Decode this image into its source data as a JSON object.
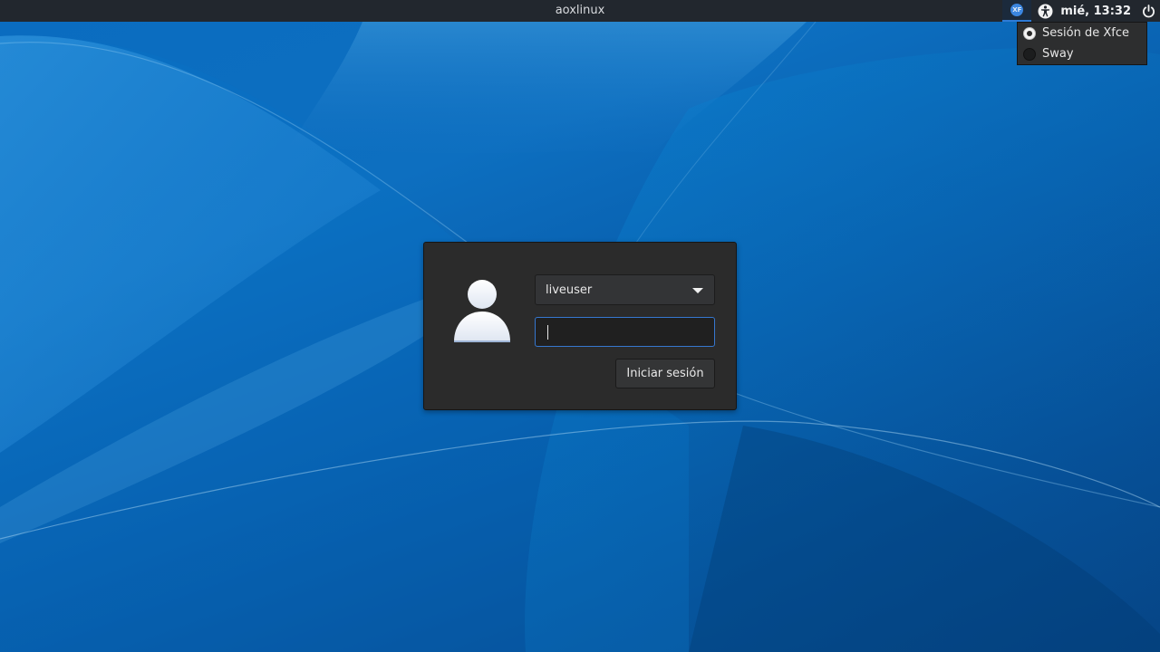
{
  "panel": {
    "hostname": "aoxlinux",
    "clock": "mié, 13:32",
    "session_indicator_label": "XF"
  },
  "session_menu": {
    "items": [
      {
        "label": "Sesión de Xfce",
        "selected": true
      },
      {
        "label": "Sway",
        "selected": false
      }
    ]
  },
  "login": {
    "username": "liveuser",
    "password_value": "",
    "login_button_label": "Iniciar sesión"
  },
  "colors": {
    "panel_bg": "#22272e",
    "accent": "#3677cf",
    "dialog_bg": "#2b2b2b"
  },
  "icons": {
    "session": "xfce-session-icon",
    "accessibility": "accessibility-icon",
    "power": "power-icon",
    "avatar": "user-avatar-icon",
    "dropdown": "chevron-down-icon"
  }
}
